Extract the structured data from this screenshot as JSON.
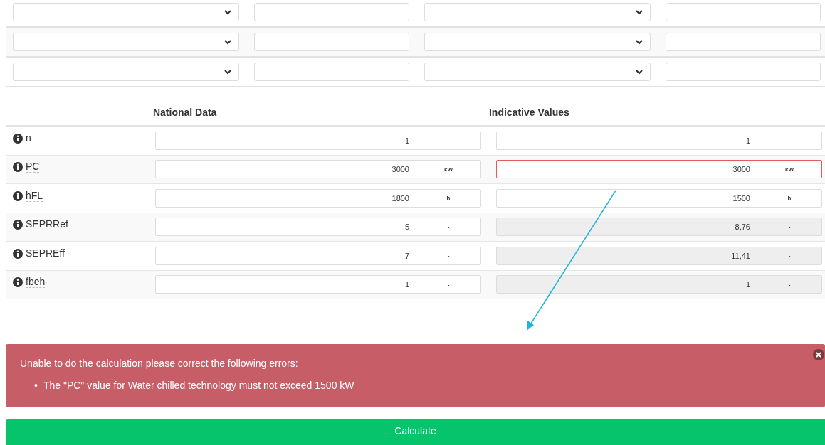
{
  "filter_rows": [
    {
      "fields": [
        {
          "kind": "select"
        },
        {
          "kind": "input"
        },
        {
          "kind": "select"
        },
        {
          "kind": "input"
        }
      ]
    },
    {
      "fields": [
        {
          "kind": "select"
        },
        {
          "kind": "input"
        },
        {
          "kind": "select"
        },
        {
          "kind": "input"
        }
      ]
    },
    {
      "fields": [
        {
          "kind": "select"
        },
        {
          "kind": "input"
        },
        {
          "kind": "select"
        },
        {
          "kind": "input"
        }
      ]
    }
  ],
  "table": {
    "columns": [
      "National Data",
      "Indicative Values"
    ],
    "rows": [
      {
        "label": "n",
        "national": {
          "value": "1",
          "unit": "-"
        },
        "indicative": {
          "value": "1",
          "unit": "-",
          "readonly": false,
          "error": false
        }
      },
      {
        "label": "PC",
        "national": {
          "value": "3000",
          "unit": "kW"
        },
        "indicative": {
          "value": "3000",
          "unit": "kW",
          "readonly": false,
          "error": true
        }
      },
      {
        "label": "hFL",
        "national": {
          "value": "1800",
          "unit": "h"
        },
        "indicative": {
          "value": "1500",
          "unit": "h",
          "readonly": false,
          "error": false
        }
      },
      {
        "label": "SEPRRef",
        "national": {
          "value": "5",
          "unit": "-"
        },
        "indicative": {
          "value": "8,76",
          "unit": "-",
          "readonly": true,
          "error": false
        }
      },
      {
        "label": "SEPREff",
        "national": {
          "value": "7",
          "unit": "-"
        },
        "indicative": {
          "value": "11,41",
          "unit": "-",
          "readonly": true,
          "error": false
        }
      },
      {
        "label": "fbeh",
        "national": {
          "value": "1",
          "unit": "-"
        },
        "indicative": {
          "value": "1",
          "unit": "-",
          "readonly": true,
          "error": false
        }
      }
    ]
  },
  "alert": {
    "message": "Unable to do the calculation please correct the following errors:",
    "errors": [
      {
        "marker": "•",
        "text": "The \"PC\" value for Water chilled technology must not exceed 1500 kW"
      }
    ]
  },
  "calculate_button": {
    "label": "Calculate"
  }
}
